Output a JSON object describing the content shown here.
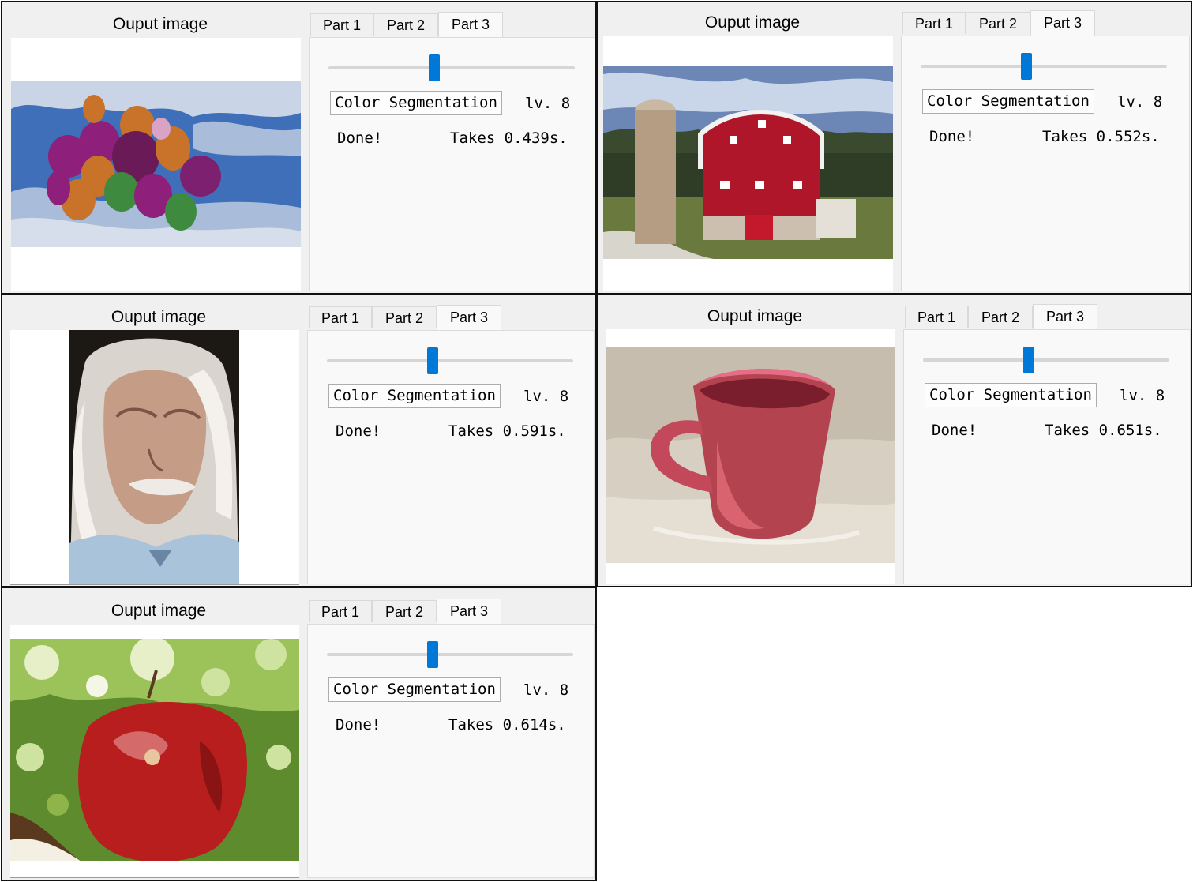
{
  "output_title": "Ouput image",
  "tabs": [
    "Part 1",
    "Part 2",
    "Part 3"
  ],
  "active_tab": "Part 3",
  "button_label": "Color Segmentation",
  "level_label": "lv. 8",
  "status": "Done!",
  "panels": [
    {
      "image": "balloons",
      "time": "Takes 0.439s.",
      "slider_value": 0.43
    },
    {
      "image": "red barn with silo",
      "time": "Takes 0.552s.",
      "slider_value": 0.43
    },
    {
      "image": "old man portrait",
      "time": "Takes 0.591s.",
      "slider_value": 0.43
    },
    {
      "image": "red mug on wooden table",
      "time": "Takes 0.651s.",
      "slider_value": 0.43
    },
    {
      "image": "red apple",
      "time": "Takes 0.614s.",
      "slider_value": 0.43
    }
  ],
  "colors": {
    "accent": "#0078d7",
    "panel_bg": "#f0f0f0",
    "page_bg": "#f9f9f9"
  }
}
